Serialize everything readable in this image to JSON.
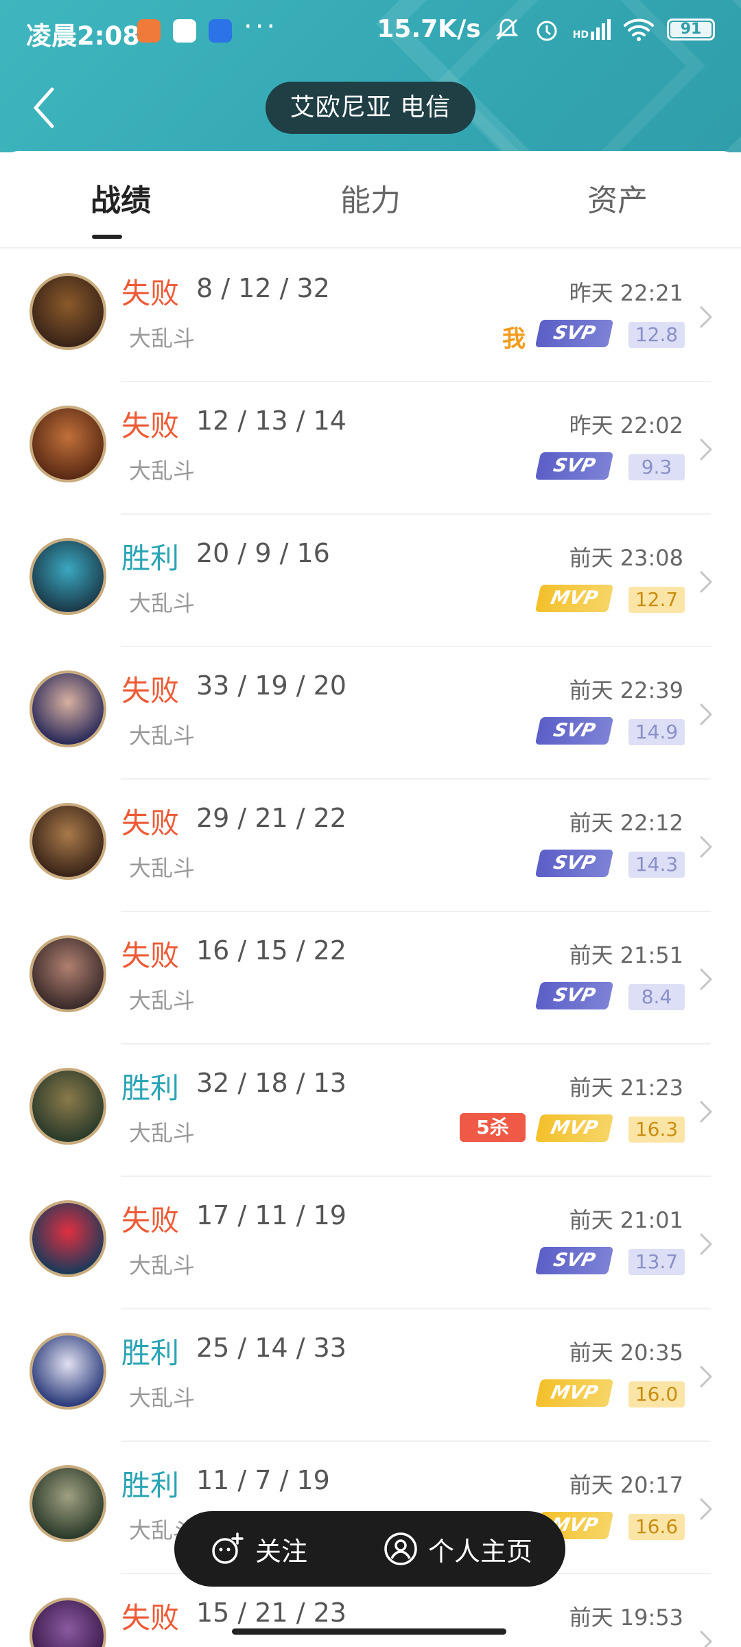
{
  "status_bar": {
    "time": "凌晨2:08",
    "dots": "···",
    "network_speed": "15.7K/s",
    "signal_label": "HD",
    "battery": "91"
  },
  "header": {
    "title": "艾欧尼亚 电信"
  },
  "tabs": [
    {
      "label": "战绩",
      "active": true
    },
    {
      "label": "能力",
      "active": false
    },
    {
      "label": "资产",
      "active": false
    }
  ],
  "matches": [
    {
      "result": "失败",
      "kda": "8 / 12 / 32",
      "mode": "大乱斗",
      "time": "昨天 22:21",
      "badge": "SVP",
      "score": "12.8",
      "extra": "我"
    },
    {
      "result": "失败",
      "kda": "12 / 13 / 14",
      "mode": "大乱斗",
      "time": "昨天 22:02",
      "badge": "SVP",
      "score": "9.3",
      "extra": ""
    },
    {
      "result": "胜利",
      "kda": "20 / 9 / 16",
      "mode": "大乱斗",
      "time": "前天 23:08",
      "badge": "MVP",
      "score": "12.7",
      "extra": ""
    },
    {
      "result": "失败",
      "kda": "33 / 19 / 20",
      "mode": "大乱斗",
      "time": "前天 22:39",
      "badge": "SVP",
      "score": "14.9",
      "extra": ""
    },
    {
      "result": "失败",
      "kda": "29 / 21 / 22",
      "mode": "大乱斗",
      "time": "前天 22:12",
      "badge": "SVP",
      "score": "14.3",
      "extra": ""
    },
    {
      "result": "失败",
      "kda": "16 / 15 / 22",
      "mode": "大乱斗",
      "time": "前天 21:51",
      "badge": "SVP",
      "score": "8.4",
      "extra": ""
    },
    {
      "result": "胜利",
      "kda": "32 / 18 / 13",
      "mode": "大乱斗",
      "time": "前天 21:23",
      "badge": "MVP",
      "score": "16.3",
      "extra": "5杀"
    },
    {
      "result": "失败",
      "kda": "17 / 11 / 19",
      "mode": "大乱斗",
      "time": "前天 21:01",
      "badge": "SVP",
      "score": "13.7",
      "extra": ""
    },
    {
      "result": "胜利",
      "kda": "25 / 14 / 33",
      "mode": "大乱斗",
      "time": "前天 20:35",
      "badge": "MVP",
      "score": "16.0",
      "extra": ""
    },
    {
      "result": "胜利",
      "kda": "11 / 7 / 19",
      "mode": "大乱斗",
      "time": "前天 20:17",
      "badge": "MVP",
      "score": "16.6",
      "extra": ""
    },
    {
      "result": "失败",
      "kda": "15 / 21 / 23",
      "mode": "",
      "time": "前天 19:53",
      "badge": "",
      "score": "",
      "extra": ""
    }
  ],
  "float_bar": {
    "follow_label": "关注",
    "profile_label": "个人主页"
  },
  "colors": {
    "header_bg": "#34a8b3",
    "lose": "#ee5a36",
    "win": "#2aa4b5",
    "svp": "#5b5fc7",
    "mvp": "#f4c02b"
  }
}
